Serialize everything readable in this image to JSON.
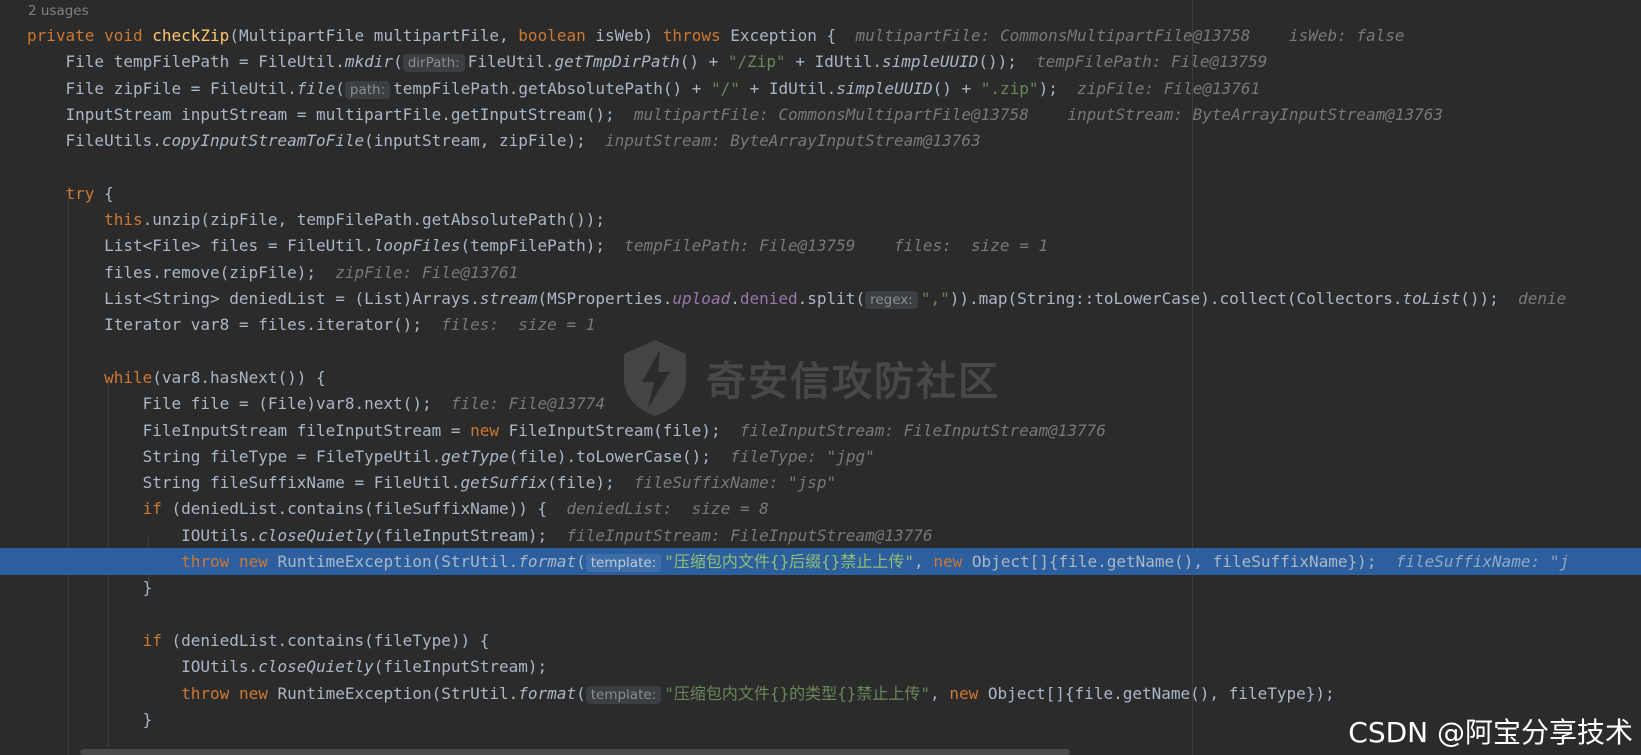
{
  "usages_label": "2 usages",
  "colors": {
    "background": "#2b2b2b",
    "keyword": "#cc7832",
    "method_declaration": "#ffc66d",
    "string": "#6a8759",
    "field": "#9876aa",
    "inlay_hint": "#787878",
    "selected_line": "#2d5f9e"
  },
  "lines": [
    {
      "highlight": false,
      "segments": [
        {
          "t": "private",
          "c": "kw"
        },
        {
          "t": " "
        },
        {
          "t": "void",
          "c": "kw"
        },
        {
          "t": " "
        },
        {
          "t": "checkZip",
          "c": "fn"
        },
        {
          "t": "(MultipartFile multipartFile, "
        },
        {
          "t": "boolean",
          "c": "kw"
        },
        {
          "t": " isWeb) "
        },
        {
          "t": "throws",
          "c": "kw"
        },
        {
          "t": " Exception {  "
        },
        {
          "t": "multipartFile: CommonsMultipartFile@13758    isWeb: false",
          "c": "hint"
        }
      ]
    },
    {
      "highlight": false,
      "segments": [
        {
          "t": "    File tempFilePath = FileUtil."
        },
        {
          "t": "mkdir",
          "c": "sm"
        },
        {
          "t": "("
        },
        {
          "t": "dirPath:",
          "c": "param"
        },
        {
          "t": "FileUtil."
        },
        {
          "t": "getTmpDirPath",
          "c": "sm"
        },
        {
          "t": "() + "
        },
        {
          "t": "\"/Zip\"",
          "c": "str"
        },
        {
          "t": " + IdUtil."
        },
        {
          "t": "simpleUUID",
          "c": "sm"
        },
        {
          "t": "());  "
        },
        {
          "t": "tempFilePath: File@13759",
          "c": "hint"
        }
      ]
    },
    {
      "highlight": false,
      "segments": [
        {
          "t": "    File zipFile = FileUtil."
        },
        {
          "t": "file",
          "c": "sm"
        },
        {
          "t": "("
        },
        {
          "t": "path:",
          "c": "param"
        },
        {
          "t": "tempFilePath.getAbsolutePath() + "
        },
        {
          "t": "\"/\"",
          "c": "str"
        },
        {
          "t": " + IdUtil."
        },
        {
          "t": "simpleUUID",
          "c": "sm"
        },
        {
          "t": "() + "
        },
        {
          "t": "\".zip\"",
          "c": "str"
        },
        {
          "t": ");  "
        },
        {
          "t": "zipFile: File@13761",
          "c": "hint"
        }
      ]
    },
    {
      "highlight": false,
      "segments": [
        {
          "t": "    InputStream inputStream = multipartFile.getInputStream();  "
        },
        {
          "t": "multipartFile: CommonsMultipartFile@13758    inputStream: ByteArrayInputStream@13763",
          "c": "hint"
        }
      ]
    },
    {
      "highlight": false,
      "segments": [
        {
          "t": "    FileUtils."
        },
        {
          "t": "copyInputStreamToFile",
          "c": "sm"
        },
        {
          "t": "(inputStream, zipFile);  "
        },
        {
          "t": "inputStream: ByteArrayInputStream@13763",
          "c": "hint"
        }
      ]
    },
    {
      "highlight": false,
      "segments": []
    },
    {
      "highlight": false,
      "segments": [
        {
          "t": "    "
        },
        {
          "t": "try",
          "c": "kw"
        },
        {
          "t": " {"
        }
      ]
    },
    {
      "highlight": false,
      "segments": [
        {
          "t": "        "
        },
        {
          "t": "this",
          "c": "kw"
        },
        {
          "t": ".unzip(zipFile, tempFilePath.getAbsolutePath());"
        }
      ]
    },
    {
      "highlight": false,
      "segments": [
        {
          "t": "        List<File> files = FileUtil."
        },
        {
          "t": "loopFiles",
          "c": "sm"
        },
        {
          "t": "(tempFilePath);  "
        },
        {
          "t": "tempFilePath: File@13759    files:  size = 1",
          "c": "hint"
        }
      ]
    },
    {
      "highlight": false,
      "segments": [
        {
          "t": "        files.remove(zipFile);  "
        },
        {
          "t": "zipFile: File@13761",
          "c": "hint"
        }
      ]
    },
    {
      "highlight": false,
      "segments": [
        {
          "t": "        List<String> deniedList = (List)Arrays."
        },
        {
          "t": "stream",
          "c": "sm"
        },
        {
          "t": "(MSProperties."
        },
        {
          "t": "upload",
          "c": "fld sm"
        },
        {
          "t": "."
        },
        {
          "t": "denied",
          "c": "fld"
        },
        {
          "t": ".split("
        },
        {
          "t": "regex:",
          "c": "param"
        },
        {
          "t": "\",\"",
          "c": "str"
        },
        {
          "t": ")).map(String::toLowerCase).collect(Collectors."
        },
        {
          "t": "toList",
          "c": "sm"
        },
        {
          "t": "());  "
        },
        {
          "t": "denie",
          "c": "hint"
        }
      ]
    },
    {
      "highlight": false,
      "segments": [
        {
          "t": "        Iterator var8 = files.iterator();  "
        },
        {
          "t": "files:  size = 1",
          "c": "hint"
        }
      ]
    },
    {
      "highlight": false,
      "segments": []
    },
    {
      "highlight": false,
      "segments": [
        {
          "t": "        "
        },
        {
          "t": "while",
          "c": "kw"
        },
        {
          "t": "(var8.hasNext()) {"
        }
      ]
    },
    {
      "highlight": false,
      "segments": [
        {
          "t": "            File file = (File)var8.next();  "
        },
        {
          "t": "file: File@13774",
          "c": "hint"
        }
      ]
    },
    {
      "highlight": false,
      "segments": [
        {
          "t": "            FileInputStream fileInputStream = "
        },
        {
          "t": "new",
          "c": "kw"
        },
        {
          "t": " FileInputStream(file);  "
        },
        {
          "t": "fileInputStream: FileInputStream@13776",
          "c": "hint"
        }
      ]
    },
    {
      "highlight": false,
      "segments": [
        {
          "t": "            String fileType = FileTypeUtil."
        },
        {
          "t": "getType",
          "c": "sm"
        },
        {
          "t": "(file).toLowerCase();  "
        },
        {
          "t": "fileType: \"jpg\"",
          "c": "hint"
        }
      ]
    },
    {
      "highlight": false,
      "segments": [
        {
          "t": "            String fileSuffixName = FileUtil."
        },
        {
          "t": "getSuffix",
          "c": "sm"
        },
        {
          "t": "(file);  "
        },
        {
          "t": "fileSuffixName: \"jsp\"",
          "c": "hint"
        }
      ]
    },
    {
      "highlight": false,
      "segments": [
        {
          "t": "            "
        },
        {
          "t": "if",
          "c": "kw"
        },
        {
          "t": " (deniedList.contains(fileSuffixName)) {  "
        },
        {
          "t": "deniedList:  size = 8",
          "c": "hint"
        }
      ]
    },
    {
      "highlight": false,
      "segments": [
        {
          "t": "                IOUtils."
        },
        {
          "t": "closeQuietly",
          "c": "sm"
        },
        {
          "t": "(fileInputStream);  "
        },
        {
          "t": "fileInputStream: FileInputStream@13776",
          "c": "hint"
        }
      ]
    },
    {
      "highlight": true,
      "segments": [
        {
          "t": "                "
        },
        {
          "t": "throw",
          "c": "kw"
        },
        {
          "t": " "
        },
        {
          "t": "new",
          "c": "kw"
        },
        {
          "t": " RuntimeException(StrUtil."
        },
        {
          "t": "format",
          "c": "sm"
        },
        {
          "t": "("
        },
        {
          "t": "template:",
          "c": "param"
        },
        {
          "t": "\"压缩包内文件{}后缀{}禁止上传\"",
          "c": "str"
        },
        {
          "t": ", "
        },
        {
          "t": "new",
          "c": "kw"
        },
        {
          "t": " Object[]{file.getName(), fileSuffixName});  "
        },
        {
          "t": "fileSuffixName: \"j",
          "c": "hint"
        }
      ]
    },
    {
      "highlight": false,
      "segments": [
        {
          "t": "            }"
        }
      ]
    },
    {
      "highlight": false,
      "segments": []
    },
    {
      "highlight": false,
      "segments": [
        {
          "t": "            "
        },
        {
          "t": "if",
          "c": "kw"
        },
        {
          "t": " (deniedList.contains(fileType)) {"
        }
      ]
    },
    {
      "highlight": false,
      "segments": [
        {
          "t": "                IOUtils."
        },
        {
          "t": "closeQuietly",
          "c": "sm"
        },
        {
          "t": "(fileInputStream);"
        }
      ]
    },
    {
      "highlight": false,
      "segments": [
        {
          "t": "                "
        },
        {
          "t": "throw",
          "c": "kw"
        },
        {
          "t": " "
        },
        {
          "t": "new",
          "c": "kw"
        },
        {
          "t": " RuntimeException(StrUtil."
        },
        {
          "t": "format",
          "c": "sm"
        },
        {
          "t": "("
        },
        {
          "t": "template:",
          "c": "param"
        },
        {
          "t": "\"压缩包内文件{}的类型{}禁止上传\"",
          "c": "str"
        },
        {
          "t": ", "
        },
        {
          "t": "new",
          "c": "kw"
        },
        {
          "t": " Object[]{file.getName(), fileType});"
        }
      ]
    },
    {
      "highlight": false,
      "segments": [
        {
          "t": "            }"
        }
      ]
    }
  ],
  "watermark_text": "奇安信攻防社区",
  "csdn_watermark": "CSDN @阿宝分享技术"
}
